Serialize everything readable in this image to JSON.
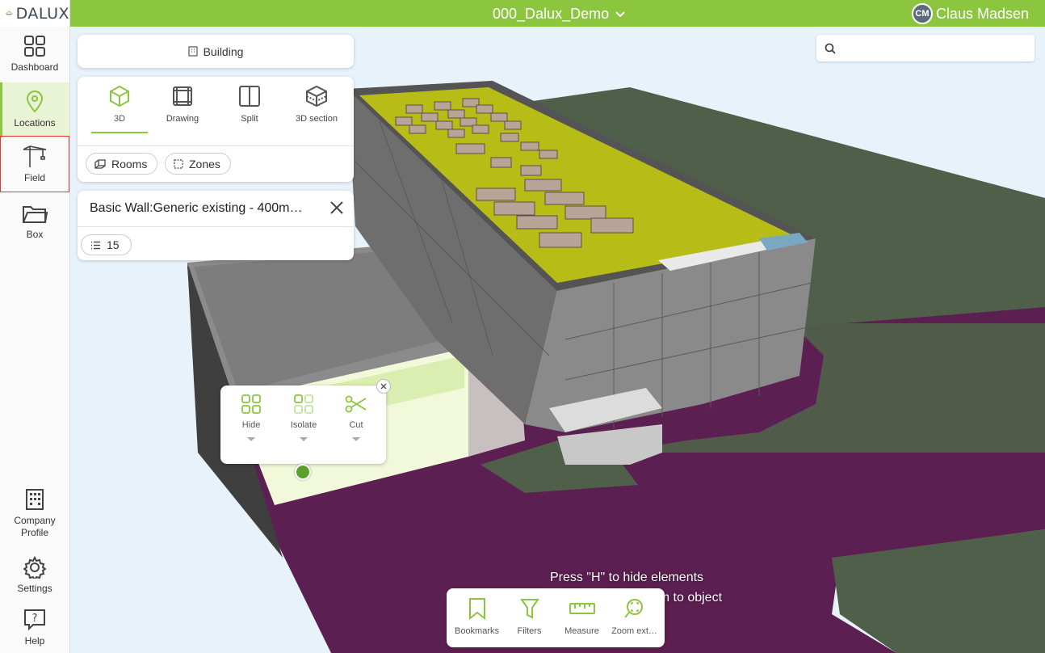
{
  "app": {
    "logo_text": "DALUX",
    "brand_color": "#8cc63f"
  },
  "header": {
    "project_title": "000_Dalux_Demo",
    "user_initials": "CM",
    "user_name": "Claus Madsen"
  },
  "sidebar": {
    "items": [
      {
        "label": "Dashboard",
        "icon": "dashboard-grid-icon"
      },
      {
        "label": "Locations",
        "icon": "location-pin-icon",
        "active": true
      },
      {
        "label": "Field",
        "icon": "crane-icon",
        "outlined": true
      },
      {
        "label": "Box",
        "icon": "folder-icon"
      }
    ],
    "bottom_items": [
      {
        "label_line1": "Company",
        "label_line2": "Profile",
        "icon": "building-icon"
      },
      {
        "label": "Settings",
        "icon": "gear-icon"
      },
      {
        "label": "Help",
        "icon": "help-icon"
      }
    ]
  },
  "building_selector": {
    "label": "Building",
    "icon": "building-icon"
  },
  "view_modes": {
    "tabs": [
      {
        "label": "3D",
        "icon": "cube-icon",
        "active": true
      },
      {
        "label": "Drawing",
        "icon": "drawing-icon"
      },
      {
        "label": "Split",
        "icon": "split-icon"
      },
      {
        "label": "3D section",
        "icon": "section-cube-icon"
      }
    ],
    "chips": [
      {
        "label": "Rooms",
        "icon": "rooms-icon"
      },
      {
        "label": "Zones",
        "icon": "zones-icon"
      }
    ]
  },
  "element_info": {
    "title": "Basic Wall:Generic existing - 400m…",
    "property_count": "15"
  },
  "search": {
    "placeholder": "",
    "value": ""
  },
  "context_menu": {
    "items": [
      {
        "label": "Hide",
        "icon": "hide-icon"
      },
      {
        "label": "Isolate",
        "icon": "isolate-icon"
      },
      {
        "label": "Cut",
        "icon": "scissors-icon"
      }
    ]
  },
  "hints": {
    "line1": "Press \"H\" to hide elements",
    "line2": "Press \"SPACE\" to zoom to object"
  },
  "toolbar": {
    "items": [
      {
        "label": "Bookmarks",
        "icon": "bookmark-icon"
      },
      {
        "label": "Filters",
        "icon": "filter-icon"
      },
      {
        "label": "Measure",
        "icon": "ruler-icon"
      },
      {
        "label": "Zoom ext…",
        "icon": "zoom-extents-icon"
      }
    ]
  },
  "colors": {
    "ground": "#5c1f52",
    "grass": "#4f5f4a",
    "roof": "#b7bd16",
    "facade": "#8a8a8a"
  }
}
